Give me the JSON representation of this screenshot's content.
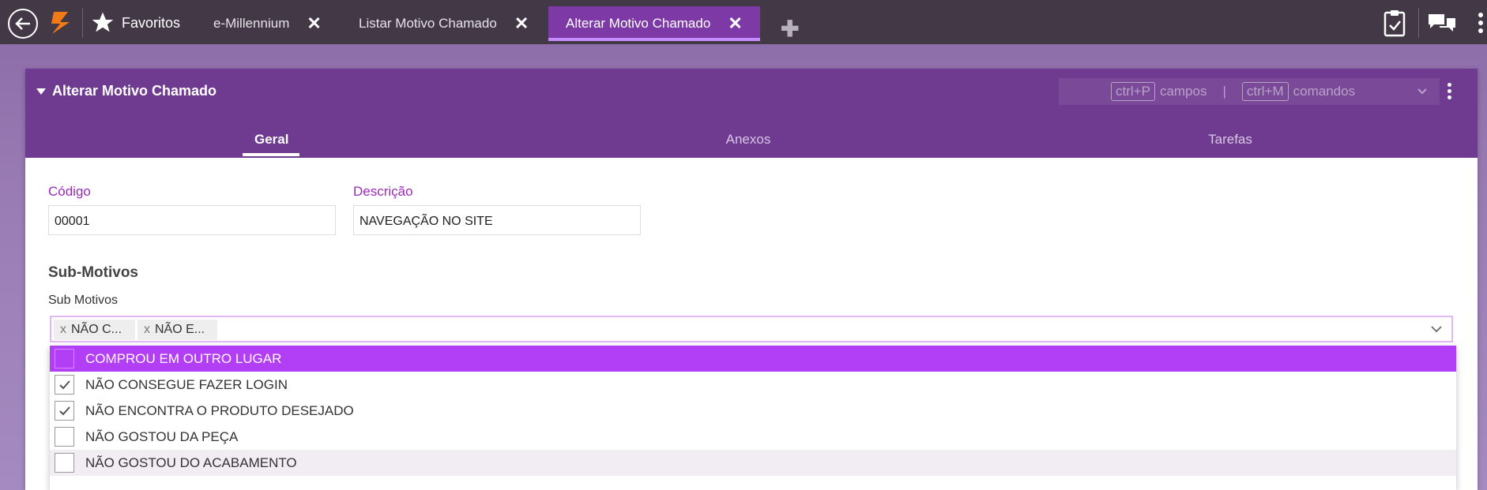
{
  "topbar": {
    "favorites_label": "Favoritos",
    "tabs": [
      {
        "label": "e-Millennium",
        "close": "✕"
      },
      {
        "label": "Listar Motivo Chamado",
        "close": "✕"
      },
      {
        "label": "Alterar Motivo Chamado",
        "close": "✕",
        "active": true
      }
    ],
    "add_tab": "✚"
  },
  "panel": {
    "title": "Alterar Motivo Chamado",
    "shortcuts": {
      "key1": "ctrl+P",
      "label1": "campos",
      "separator": "|",
      "key2": "ctrl+M",
      "label2": "comandos"
    },
    "tabs": [
      "Geral",
      "Anexos",
      "Tarefas"
    ],
    "active_tab": "Geral"
  },
  "form": {
    "codigo_label": "Código",
    "codigo_value": "00001",
    "descricao_label": "Descrição",
    "descricao_value": "NAVEGAÇÃO NO SITE",
    "section_title": "Sub-Motivos",
    "submotivos_label": "Sub Motivos",
    "chips": [
      {
        "x": "x",
        "text": "NÃO C..."
      },
      {
        "x": "x",
        "text": "NÃO E..."
      }
    ],
    "options": [
      {
        "label": "COMPROU EM OUTRO LUGAR",
        "checked": false,
        "state": "highlighted"
      },
      {
        "label": "NÃO CONSEGUE FAZER LOGIN",
        "checked": true
      },
      {
        "label": "NÃO ENCONTRA O PRODUTO DESEJADO",
        "checked": true
      },
      {
        "label": "NÃO GOSTOU DA PEÇA",
        "checked": false
      },
      {
        "label": "NÃO GOSTOU DO ACABAMENTO",
        "checked": false,
        "state": "hover"
      }
    ]
  },
  "colors": {
    "topbar": "#433946",
    "panel_header": "#6f3b90",
    "accent": "#b23ff5",
    "label": "#9b2ab8"
  }
}
